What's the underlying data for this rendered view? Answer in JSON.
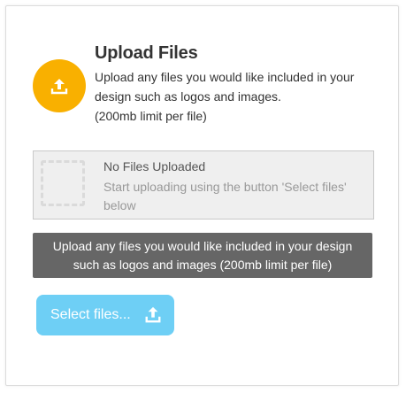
{
  "colors": {
    "accent_orange": "#f9b000",
    "info_bar_bg": "#666666",
    "button_bg": "#6ecff5"
  },
  "header": {
    "icon": "upload-icon",
    "title": "Upload Files",
    "description_line1": "Upload any files you would like included in your",
    "description_line2": "design such as logos and images.",
    "description_line3": "(200mb limit per file)"
  },
  "empty_state": {
    "icon": "dashed-placeholder",
    "title": "No Files Uploaded",
    "subtitle": "Start uploading using the button 'Select files' below"
  },
  "info_bar": {
    "line1": "Upload any files you would like included in your design",
    "line2": "such as logos and images (200mb limit per file)"
  },
  "select_button": {
    "label": "Select files...",
    "icon": "upload-icon"
  }
}
